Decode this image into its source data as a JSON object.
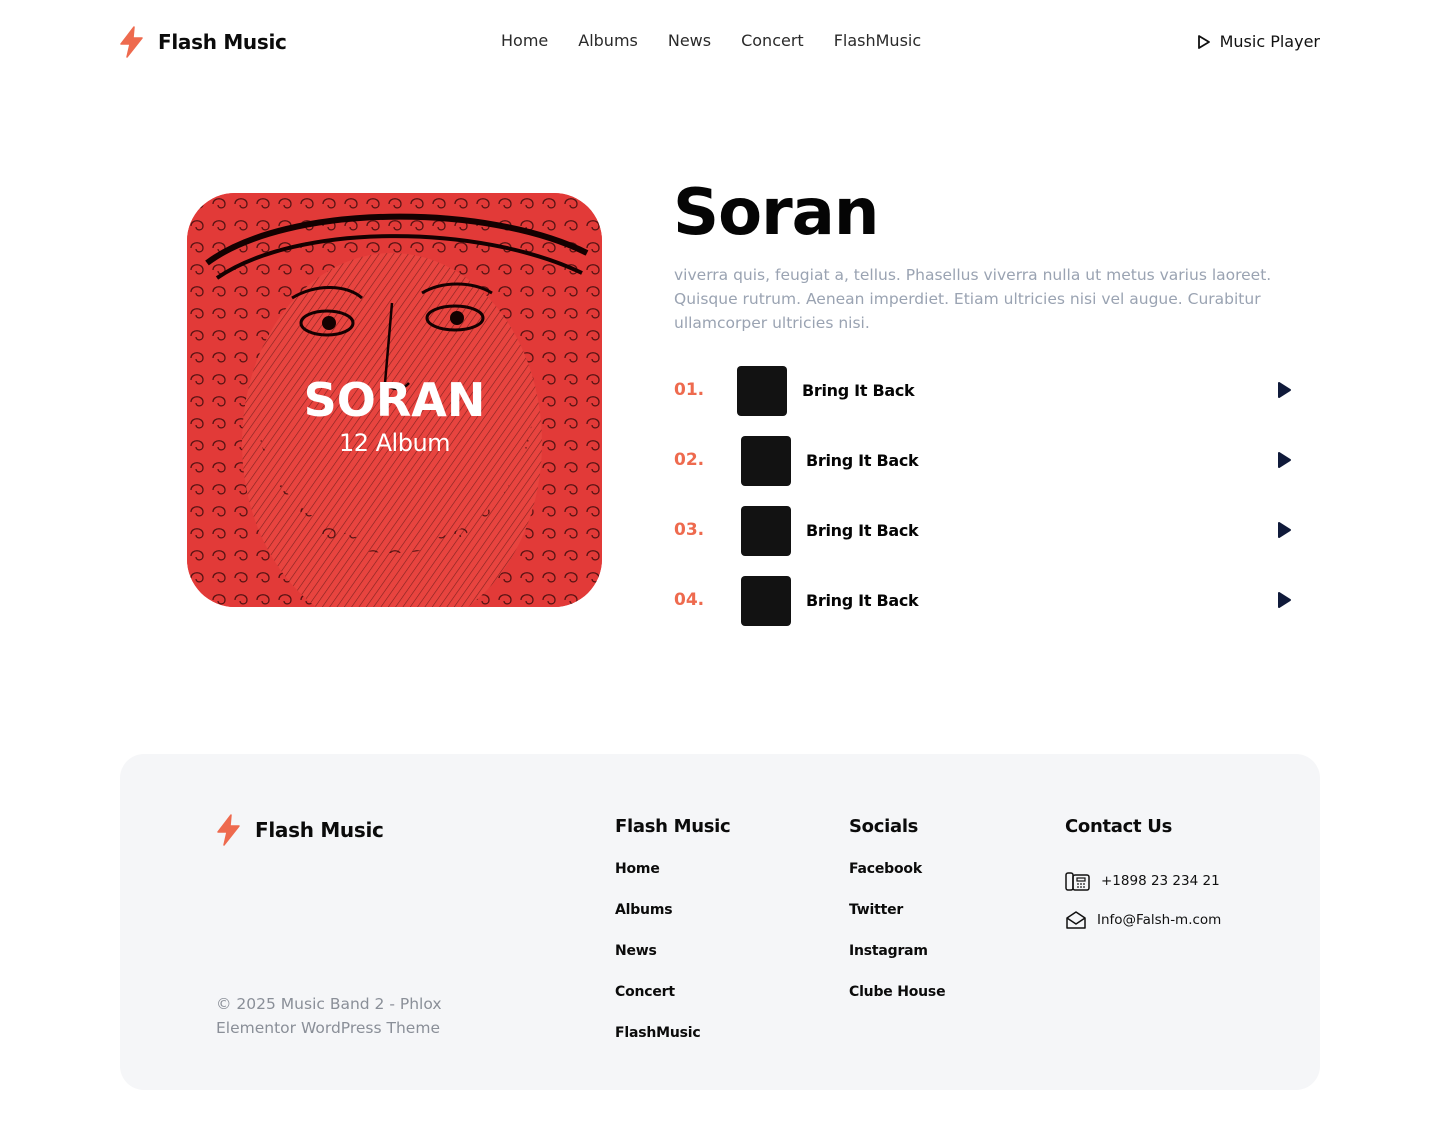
{
  "header": {
    "brand": "Flash Music",
    "nav": [
      "Home",
      "Albums",
      "News",
      "Concert",
      "FlashMusic"
    ],
    "player_label": "Music Player"
  },
  "album": {
    "cover_title": "SORAN",
    "cover_subtitle": "12 Album",
    "title": "Soran",
    "description": "viverra quis, feugiat a, tellus. Phasellus viverra nulla ut metus varius laoreet. Quisque rutrum. Aenean imperdiet. Etiam ultricies nisi vel augue. Curabitur ullamcorper ultricies nisi.",
    "tracks": [
      {
        "number": "01.",
        "name": "Bring It Back"
      },
      {
        "number": "02.",
        "name": "Bring It Back"
      },
      {
        "number": "03.",
        "name": "Bring It Back"
      },
      {
        "number": "04.",
        "name": "Bring It Back"
      }
    ]
  },
  "footer": {
    "brand": "Flash Music",
    "copyright": "© 2025 Music Band 2 - Phlox Elementor WordPress Theme",
    "col1": {
      "title": "Flash Music",
      "links": [
        "Home",
        "Albums",
        "News",
        "Concert",
        "FlashMusic"
      ]
    },
    "col2": {
      "title": "Socials",
      "links": [
        "Facebook",
        "Twitter",
        "Instagram",
        "Clube House"
      ]
    },
    "col3": {
      "title": "Contact Us",
      "phone": "+1898 23 234 21",
      "email": "Info@Falsh-m.com"
    }
  },
  "colors": {
    "accent": "#ee6a4e",
    "play_icon": "#101a3a",
    "cover_red": "#e23a38"
  },
  "icons": [
    "bolt-icon",
    "play-outline-icon",
    "play-icon",
    "phone-icon",
    "envelope-icon"
  ]
}
